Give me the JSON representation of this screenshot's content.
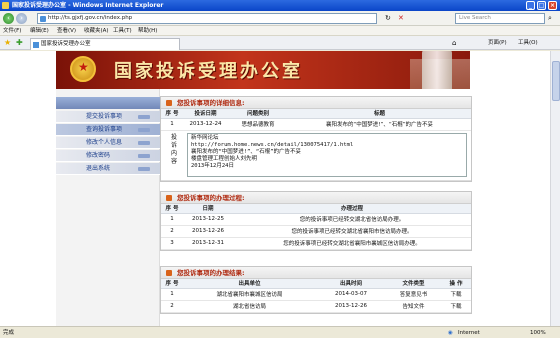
{
  "window": {
    "title": "国家投诉受理办公室 - Windows Internet Explorer"
  },
  "address": {
    "url": "http://ts.gjxfj.gov.cn/index.php",
    "search_placeholder": "Live Search"
  },
  "menu": {
    "items": [
      "文件(F)",
      "编辑(E)",
      "查看(V)",
      "收藏夹(A)",
      "工具(T)",
      "帮助(H)"
    ]
  },
  "tab": {
    "label": "国家投诉受理办公室"
  },
  "toolbar_right": {
    "home": "⌂",
    "page": "页面(P)",
    "tools": "工具(O)"
  },
  "banner": {
    "title": "国家投诉受理办公室"
  },
  "sidebar": {
    "items": [
      "提交投诉事项",
      "查询投诉事项",
      "修改个人信息",
      "修改密码",
      "退出系统"
    ],
    "active_index": 1
  },
  "details": {
    "title": "您投诉事项的详细信息:",
    "columns": [
      "序 号",
      "投诉日期",
      "问题类别",
      "标题"
    ],
    "rows": [
      [
        "1",
        "2013-12-24",
        "思想品德教育",
        "襄阳发布的“中国梦进!”、“石棍”的广告不妥"
      ]
    ],
    "content_label": "投诉内容",
    "content": "新华网论坛\nhttp://forum.home.news.cn/detail/130075417/1.html\n襄阳发布的“中国梦进!”、“石棍”的广告不妥\n楼盘管理工程创始人刘先明\n2013年12月24日"
  },
  "process": {
    "title": "您投诉事项的办理过程:",
    "columns": [
      "序 号",
      "日期",
      "办理过程"
    ],
    "rows": [
      [
        "1",
        "2013-12-25",
        "您的投诉事项已经转交湖北省信访局办理。"
      ],
      [
        "2",
        "2013-12-26",
        "您的投诉事项已经转交湖北省襄阳市信访局办理。"
      ],
      [
        "3",
        "2013-12-31",
        "您的投诉事项已经转交湖北省襄阳市襄城区信访局办理。"
      ]
    ]
  },
  "result": {
    "title": "您投诉事项的办理结果:",
    "columns": [
      "序 号",
      "出具单位",
      "出具时间",
      "文件类型",
      "操 作"
    ],
    "rows": [
      [
        "1",
        "湖北省襄阳市襄城区信访局",
        "2014-03-07",
        "答复意见书",
        "下载"
      ],
      [
        "2",
        "湖北省信访局",
        "2013-12-26",
        "告知文件",
        "下载"
      ]
    ]
  },
  "status": {
    "left": "完成",
    "zone": "Internet",
    "zoom": "100%"
  }
}
